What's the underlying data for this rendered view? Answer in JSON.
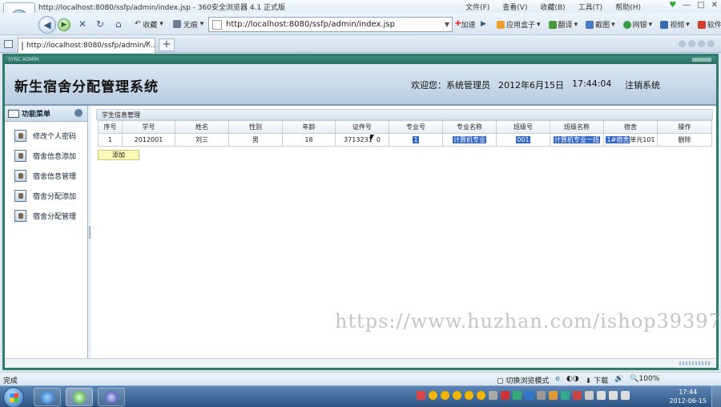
{
  "browser": {
    "title": "http://localhost:8080/ssfp/admin/index.jsp - 360安全浏览器 4.1 正式版",
    "menu": [
      "文件(F)",
      "查看(V)",
      "收藏(B)",
      "工具(T)",
      "帮助(H)"
    ],
    "nav": {
      "back_label": "收藏",
      "fav_label": "无痕",
      "url": "http://localhost:8080/ssfp/admin/index.jsp",
      "accelerate_label": "加速",
      "tools": [
        "应用盒子",
        "翻译",
        "截图",
        "网银",
        "视频",
        "软件宝库"
      ]
    },
    "tab": {
      "label": "http://localhost:8080/ssfp/admin/i...",
      "new_tab": "+"
    },
    "status": {
      "left": "完成",
      "mode": "切换浏览模式",
      "download": "下载",
      "zoom": "100%"
    }
  },
  "app": {
    "system_title": "新生宿舍分配管理系统",
    "welcome": "欢迎您：系统管理员",
    "date": "2012年6月15日",
    "time": "17:44:04",
    "logout": "注销系统",
    "frame_mini": "SYNC ADMIN"
  },
  "sidebar": {
    "header": "功能菜单",
    "items": [
      {
        "label": "修改个人密码"
      },
      {
        "label": "宿舍信息添加"
      },
      {
        "label": "宿舍信息管理"
      },
      {
        "label": "宿舍分配添加"
      },
      {
        "label": "宿舍分配管理"
      }
    ]
  },
  "main": {
    "panel_title": "学生信息管理",
    "columns": [
      "序号",
      "学号",
      "姓名",
      "性别",
      "年龄",
      "证件号",
      "专业号",
      "专业名称",
      "班级号",
      "班级名称",
      "宿舍",
      "操作"
    ],
    "rows": [
      {
        "no": "1",
        "student_id": "2012001",
        "name": "刘三",
        "gender": "男",
        "age": "18",
        "id_card": "3713231",
        "id_card_tail": "0",
        "major_no": "1",
        "major_name": "计算机专业",
        "class_no": "001",
        "class_name": "计算机专业一班",
        "dorm_sel": "1#宿舍",
        "dorm_rest": "单元101",
        "action": "删除"
      }
    ],
    "add_button": "添加"
  },
  "watermark": "https://www.huzhan.com/ishop39397",
  "taskbar": {
    "clock_time": "17:44",
    "clock_date": "2012-06-15"
  }
}
